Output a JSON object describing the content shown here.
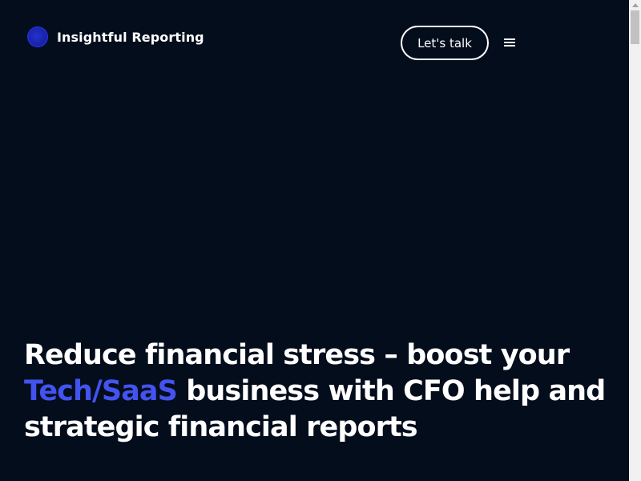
{
  "header": {
    "brand_name": "Insightful Reporting",
    "logo_icon": "circle-logo-icon",
    "cta_label": "Let's talk",
    "menu_icon": "hamburger-menu-icon"
  },
  "hero": {
    "heading_part1": "Reduce financial stress – boost your ",
    "heading_accent": "Tech/SaaS",
    "heading_part2": " business with CFO help and strategic financial reports"
  },
  "colors": {
    "background": "#040d1c",
    "accent": "#4353f0",
    "logo": "#1f2fd6",
    "text": "#ffffff"
  }
}
